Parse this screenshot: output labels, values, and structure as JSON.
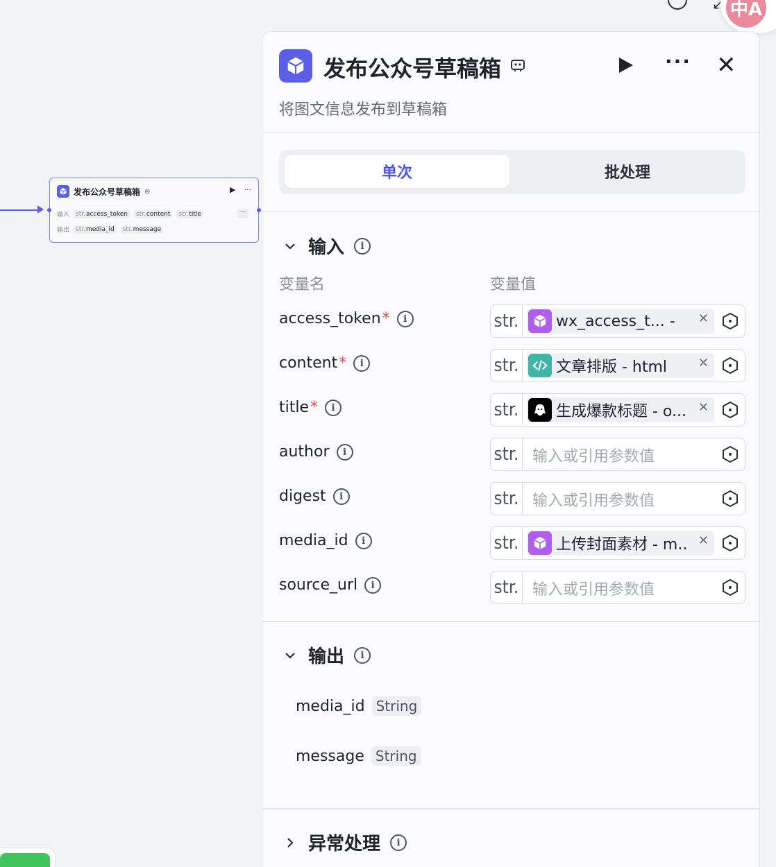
{
  "canvas_node": {
    "title": "发布公众号草稿箱",
    "input_label": "输入",
    "output_label": "输出",
    "inputs": [
      {
        "type": "str.",
        "name": "access_token"
      },
      {
        "type": "str.",
        "name": "content"
      },
      {
        "type": "str.",
        "name": "title"
      }
    ],
    "outputs": [
      {
        "type": "str.",
        "name": "media_id"
      },
      {
        "type": "str.",
        "name": "message"
      }
    ],
    "more_label": "···"
  },
  "panel": {
    "title": "发布公众号草稿箱",
    "description": "将图文信息发布到草稿箱",
    "tabs": [
      {
        "label": "单次",
        "active": true
      },
      {
        "label": "批处理",
        "active": false
      }
    ],
    "input_section": {
      "title": "输入",
      "col_name": "变量名",
      "col_value": "变量值",
      "rows": [
        {
          "name": "access_token",
          "required": true,
          "type": "str.",
          "ref": "wx_access_t...  -",
          "ref_icon": "cube-icon",
          "ref_color": "#b15ef0"
        },
        {
          "name": "content",
          "required": true,
          "type": "str.",
          "ref": "文章排版 - html",
          "ref_icon": "code-icon",
          "ref_color": "#3fb6a8"
        },
        {
          "name": "title",
          "required": true,
          "type": "str.",
          "ref": "生成爆款标题 - o...",
          "ref_icon": "llm-icon",
          "ref_color": "#000000"
        },
        {
          "name": "author",
          "required": false,
          "type": "str.",
          "placeholder": "输入或引用参数值"
        },
        {
          "name": "digest",
          "required": false,
          "type": "str.",
          "placeholder": "输入或引用参数值"
        },
        {
          "name": "media_id",
          "required": false,
          "type": "str.",
          "ref": "上传封面素材 - m..",
          "ref_icon": "cube-icon",
          "ref_color": "#b15ef0"
        },
        {
          "name": "source_url",
          "required": false,
          "type": "str.",
          "placeholder": "输入或引用参数值"
        }
      ]
    },
    "output_section": {
      "title": "输出",
      "rows": [
        {
          "name": "media_id",
          "type": "String"
        },
        {
          "name": "message",
          "type": "String"
        }
      ]
    },
    "error_section": {
      "title": "异常处理"
    }
  },
  "colors": {
    "accent": "#4d53e8",
    "node_accent": "#5b5fe8",
    "required": "#e5484d"
  }
}
